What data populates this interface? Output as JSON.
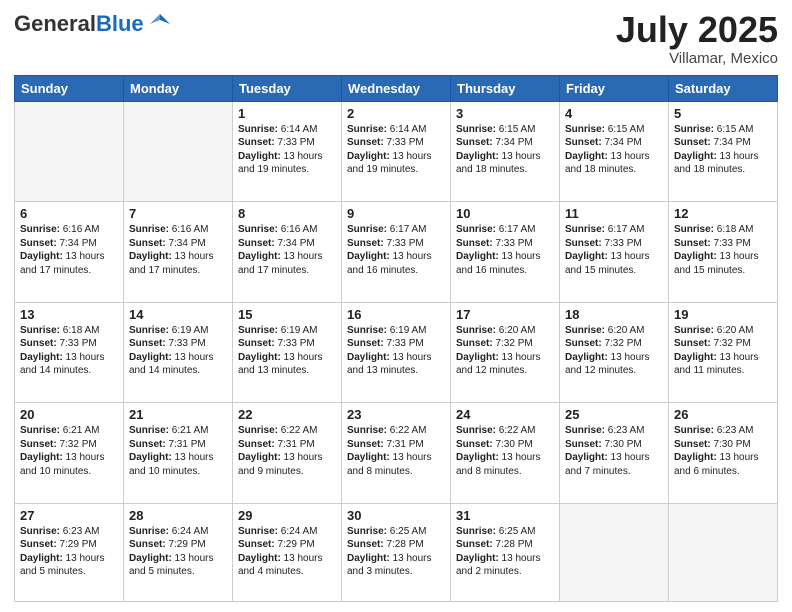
{
  "header": {
    "logo_general": "General",
    "logo_blue": "Blue",
    "month_year": "July 2025",
    "location": "Villamar, Mexico"
  },
  "days_of_week": [
    "Sunday",
    "Monday",
    "Tuesday",
    "Wednesday",
    "Thursday",
    "Friday",
    "Saturday"
  ],
  "weeks": [
    [
      {
        "day": "",
        "info": "",
        "empty": true
      },
      {
        "day": "",
        "info": "",
        "empty": true
      },
      {
        "day": "1",
        "info": "Sunrise: 6:14 AM\nSunset: 7:33 PM\nDaylight: 13 hours and 19 minutes."
      },
      {
        "day": "2",
        "info": "Sunrise: 6:14 AM\nSunset: 7:33 PM\nDaylight: 13 hours and 19 minutes."
      },
      {
        "day": "3",
        "info": "Sunrise: 6:15 AM\nSunset: 7:34 PM\nDaylight: 13 hours and 18 minutes."
      },
      {
        "day": "4",
        "info": "Sunrise: 6:15 AM\nSunset: 7:34 PM\nDaylight: 13 hours and 18 minutes."
      },
      {
        "day": "5",
        "info": "Sunrise: 6:15 AM\nSunset: 7:34 PM\nDaylight: 13 hours and 18 minutes."
      }
    ],
    [
      {
        "day": "6",
        "info": "Sunrise: 6:16 AM\nSunset: 7:34 PM\nDaylight: 13 hours and 17 minutes."
      },
      {
        "day": "7",
        "info": "Sunrise: 6:16 AM\nSunset: 7:34 PM\nDaylight: 13 hours and 17 minutes."
      },
      {
        "day": "8",
        "info": "Sunrise: 6:16 AM\nSunset: 7:34 PM\nDaylight: 13 hours and 17 minutes."
      },
      {
        "day": "9",
        "info": "Sunrise: 6:17 AM\nSunset: 7:33 PM\nDaylight: 13 hours and 16 minutes."
      },
      {
        "day": "10",
        "info": "Sunrise: 6:17 AM\nSunset: 7:33 PM\nDaylight: 13 hours and 16 minutes."
      },
      {
        "day": "11",
        "info": "Sunrise: 6:17 AM\nSunset: 7:33 PM\nDaylight: 13 hours and 15 minutes."
      },
      {
        "day": "12",
        "info": "Sunrise: 6:18 AM\nSunset: 7:33 PM\nDaylight: 13 hours and 15 minutes."
      }
    ],
    [
      {
        "day": "13",
        "info": "Sunrise: 6:18 AM\nSunset: 7:33 PM\nDaylight: 13 hours and 14 minutes."
      },
      {
        "day": "14",
        "info": "Sunrise: 6:19 AM\nSunset: 7:33 PM\nDaylight: 13 hours and 14 minutes."
      },
      {
        "day": "15",
        "info": "Sunrise: 6:19 AM\nSunset: 7:33 PM\nDaylight: 13 hours and 13 minutes."
      },
      {
        "day": "16",
        "info": "Sunrise: 6:19 AM\nSunset: 7:33 PM\nDaylight: 13 hours and 13 minutes."
      },
      {
        "day": "17",
        "info": "Sunrise: 6:20 AM\nSunset: 7:32 PM\nDaylight: 13 hours and 12 minutes."
      },
      {
        "day": "18",
        "info": "Sunrise: 6:20 AM\nSunset: 7:32 PM\nDaylight: 13 hours and 12 minutes."
      },
      {
        "day": "19",
        "info": "Sunrise: 6:20 AM\nSunset: 7:32 PM\nDaylight: 13 hours and 11 minutes."
      }
    ],
    [
      {
        "day": "20",
        "info": "Sunrise: 6:21 AM\nSunset: 7:32 PM\nDaylight: 13 hours and 10 minutes."
      },
      {
        "day": "21",
        "info": "Sunrise: 6:21 AM\nSunset: 7:31 PM\nDaylight: 13 hours and 10 minutes."
      },
      {
        "day": "22",
        "info": "Sunrise: 6:22 AM\nSunset: 7:31 PM\nDaylight: 13 hours and 9 minutes."
      },
      {
        "day": "23",
        "info": "Sunrise: 6:22 AM\nSunset: 7:31 PM\nDaylight: 13 hours and 8 minutes."
      },
      {
        "day": "24",
        "info": "Sunrise: 6:22 AM\nSunset: 7:30 PM\nDaylight: 13 hours and 8 minutes."
      },
      {
        "day": "25",
        "info": "Sunrise: 6:23 AM\nSunset: 7:30 PM\nDaylight: 13 hours and 7 minutes."
      },
      {
        "day": "26",
        "info": "Sunrise: 6:23 AM\nSunset: 7:30 PM\nDaylight: 13 hours and 6 minutes."
      }
    ],
    [
      {
        "day": "27",
        "info": "Sunrise: 6:23 AM\nSunset: 7:29 PM\nDaylight: 13 hours and 5 minutes."
      },
      {
        "day": "28",
        "info": "Sunrise: 6:24 AM\nSunset: 7:29 PM\nDaylight: 13 hours and 5 minutes."
      },
      {
        "day": "29",
        "info": "Sunrise: 6:24 AM\nSunset: 7:29 PM\nDaylight: 13 hours and 4 minutes."
      },
      {
        "day": "30",
        "info": "Sunrise: 6:25 AM\nSunset: 7:28 PM\nDaylight: 13 hours and 3 minutes."
      },
      {
        "day": "31",
        "info": "Sunrise: 6:25 AM\nSunset: 7:28 PM\nDaylight: 13 hours and 2 minutes."
      },
      {
        "day": "",
        "info": "",
        "empty": true
      },
      {
        "day": "",
        "info": "",
        "empty": true
      }
    ]
  ]
}
